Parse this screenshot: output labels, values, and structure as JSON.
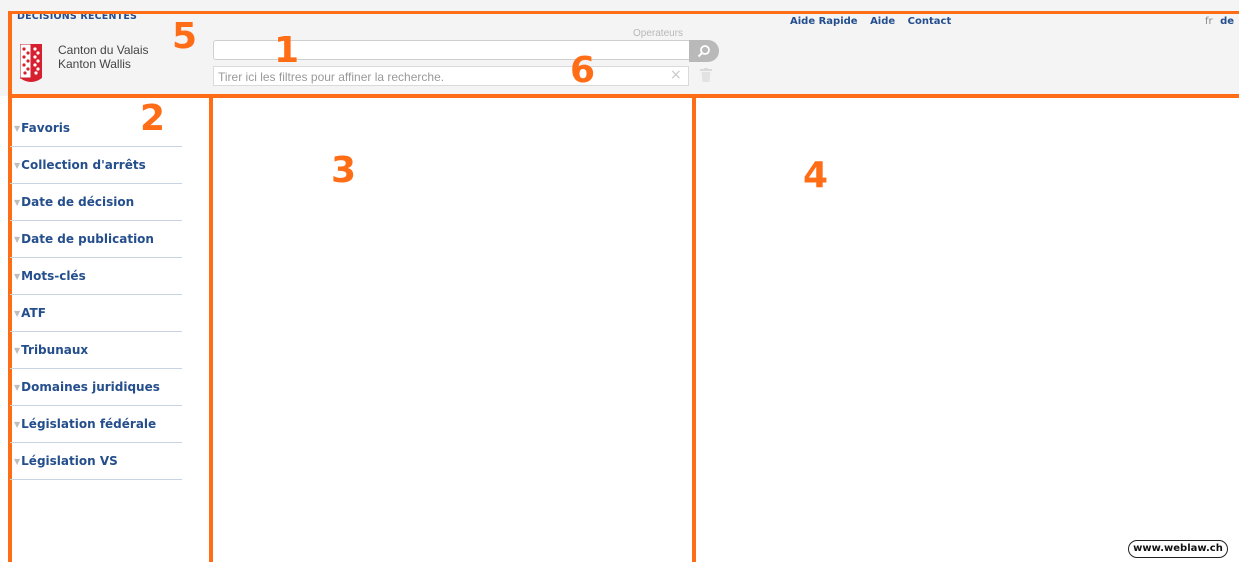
{
  "header": {
    "site_title": "DECISIONS RECENTES",
    "canton_line1": "Canton du Valais",
    "canton_line2": "Kanton Wallis",
    "operators_label": "Operateurs",
    "search_value": "",
    "search_icon": "search-icon",
    "filter_placeholder": "Tirer ici les filtres pour affiner la recherche.",
    "filter_clear_symbol": "×",
    "links": [
      "Aide Rapide",
      "Aide",
      "Contact"
    ],
    "languages": [
      "fr",
      "de"
    ]
  },
  "sidebar": {
    "items": [
      {
        "label": "Favoris"
      },
      {
        "label": "Collection d'arrêts"
      },
      {
        "label": "Date de décision"
      },
      {
        "label": "Date de publication"
      },
      {
        "label": "Mots-clés"
      },
      {
        "label": "ATF"
      },
      {
        "label": "Tribunaux"
      },
      {
        "label": "Domaines juridiques"
      },
      {
        "label": "Législation fédérale"
      },
      {
        "label": "Législation VS"
      }
    ]
  },
  "callouts": [
    "1",
    "2",
    "3",
    "4",
    "5",
    "6"
  ],
  "footer": {
    "badge": "www.weblaw.ch"
  },
  "colors": {
    "accent": "#ff6d17",
    "link": "#244e8c",
    "header_bg": "#f4f4f4"
  }
}
